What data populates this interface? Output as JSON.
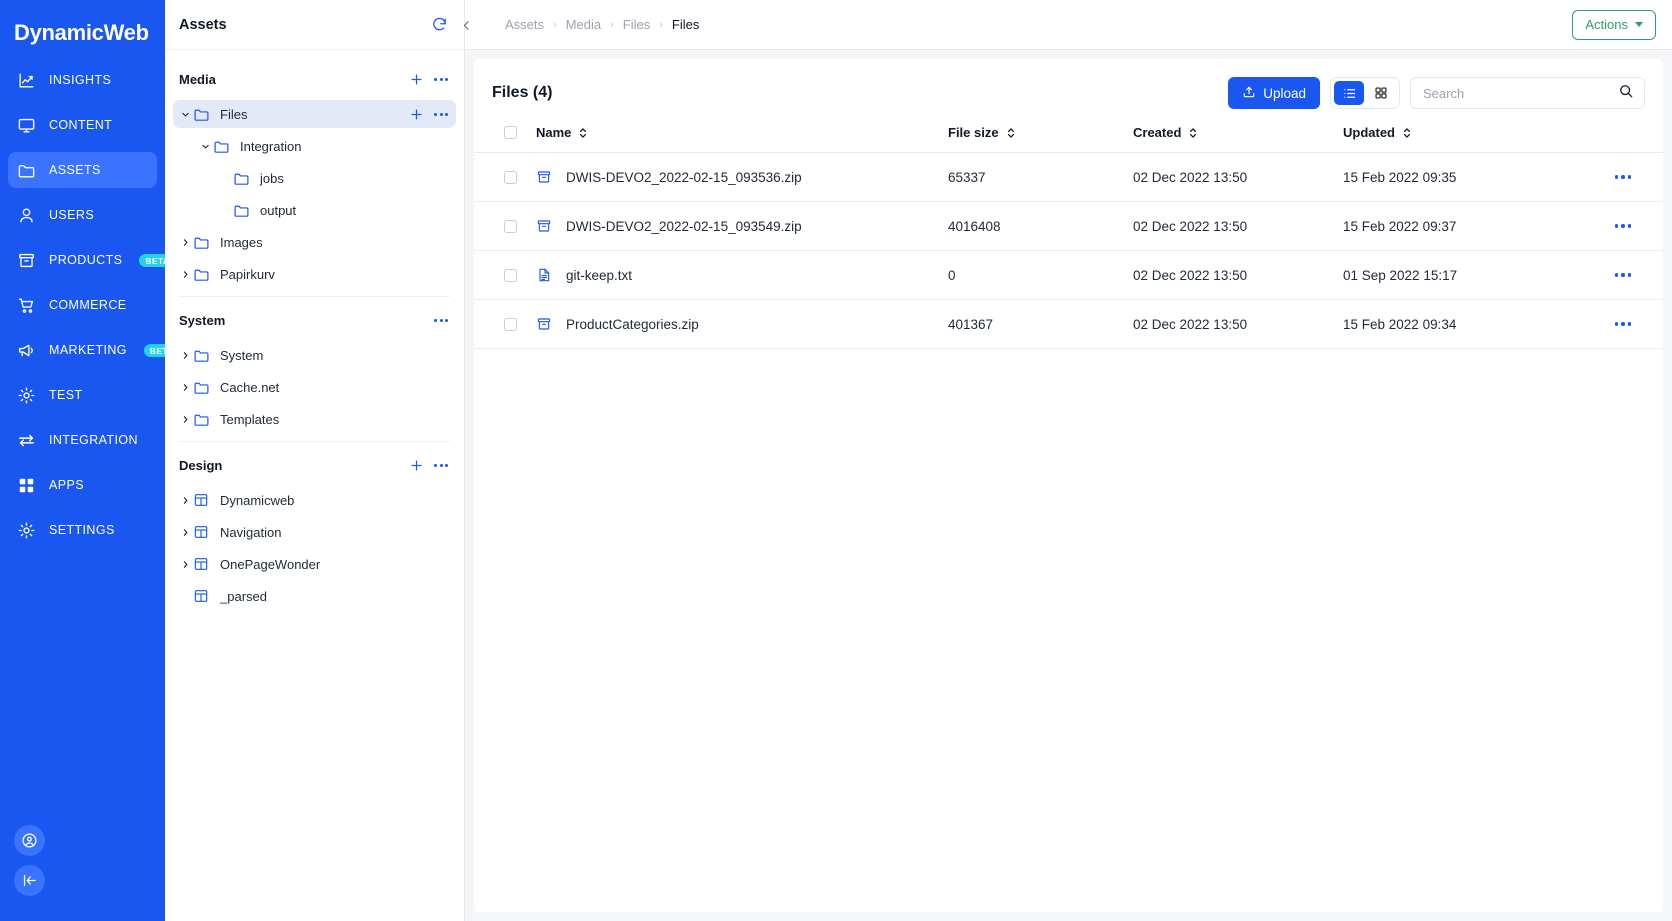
{
  "brand": {
    "name": "DynamicWeb",
    "accent": "#1a56f0",
    "accent_active": "#3a73ff",
    "beta_color": "#22d3ee",
    "actions_color": "#2e9e6b"
  },
  "nav": {
    "items": [
      {
        "label": "INSIGHTS",
        "icon": "chart-line-icon",
        "active": false,
        "badge": ""
      },
      {
        "label": "CONTENT",
        "icon": "monitor-icon",
        "active": false,
        "badge": ""
      },
      {
        "label": "ASSETS",
        "icon": "folder-icon",
        "active": true,
        "badge": ""
      },
      {
        "label": "USERS",
        "icon": "user-icon",
        "active": false,
        "badge": ""
      },
      {
        "label": "PRODUCTS",
        "icon": "archive-icon",
        "active": false,
        "badge": "BETA"
      },
      {
        "label": "COMMERCE",
        "icon": "cart-icon",
        "active": false,
        "badge": ""
      },
      {
        "label": "MARKETING",
        "icon": "megaphone-icon",
        "active": false,
        "badge": "BETA"
      },
      {
        "label": "TEST",
        "icon": "gear-icon",
        "active": false,
        "badge": ""
      },
      {
        "label": "INTEGRATION",
        "icon": "arrows-swap-icon",
        "active": false,
        "badge": ""
      },
      {
        "label": "APPS",
        "icon": "grid-icon",
        "active": false,
        "badge": ""
      },
      {
        "label": "SETTINGS",
        "icon": "gear-icon",
        "active": false,
        "badge": ""
      }
    ],
    "bottom": [
      {
        "icon": "account-circle-icon"
      },
      {
        "icon": "collapse-left-icon"
      }
    ]
  },
  "tree": {
    "title": "Assets",
    "refresh_icon": "refresh-icon",
    "groups": [
      {
        "title": "Media",
        "has_add": true,
        "has_more": true,
        "nodes": [
          {
            "label": "Files",
            "icon": "folder-icon",
            "indent": 0,
            "caret": "down",
            "selected": true,
            "has_add": true,
            "has_more": true
          },
          {
            "label": "Integration",
            "icon": "folder-icon",
            "indent": 1,
            "caret": "down",
            "selected": false,
            "has_add": false,
            "has_more": false
          },
          {
            "label": "jobs",
            "icon": "folder-icon",
            "indent": 2,
            "caret": "none",
            "selected": false,
            "has_add": false,
            "has_more": false
          },
          {
            "label": "output",
            "icon": "folder-icon",
            "indent": 2,
            "caret": "none",
            "selected": false,
            "has_add": false,
            "has_more": false
          },
          {
            "label": "Images",
            "icon": "folder-icon",
            "indent": 0,
            "caret": "right",
            "selected": false,
            "has_add": false,
            "has_more": false
          },
          {
            "label": "Papirkurv",
            "icon": "folder-icon",
            "indent": 0,
            "caret": "right",
            "selected": false,
            "has_add": false,
            "has_more": false
          }
        ]
      },
      {
        "title": "System",
        "has_add": false,
        "has_more": true,
        "nodes": [
          {
            "label": "System",
            "icon": "folder-icon",
            "indent": 0,
            "caret": "right",
            "selected": false,
            "has_add": false,
            "has_more": false
          },
          {
            "label": "Cache.net",
            "icon": "folder-icon",
            "indent": 0,
            "caret": "right",
            "selected": false,
            "has_add": false,
            "has_more": false
          },
          {
            "label": "Templates",
            "icon": "folder-icon",
            "indent": 0,
            "caret": "right",
            "selected": false,
            "has_add": false,
            "has_more": false
          }
        ]
      },
      {
        "title": "Design",
        "has_add": true,
        "has_more": true,
        "nodes": [
          {
            "label": "Dynamicweb",
            "icon": "layout-icon",
            "indent": 0,
            "caret": "right",
            "selected": false,
            "has_add": false,
            "has_more": false
          },
          {
            "label": "Navigation",
            "icon": "layout-icon",
            "indent": 0,
            "caret": "right",
            "selected": false,
            "has_add": false,
            "has_more": false
          },
          {
            "label": "OnePageWonder",
            "icon": "layout-icon",
            "indent": 0,
            "caret": "right",
            "selected": false,
            "has_add": false,
            "has_more": false
          },
          {
            "label": "_parsed",
            "icon": "layout-icon",
            "indent": 0,
            "caret": "none",
            "selected": false,
            "has_add": false,
            "has_more": false
          }
        ]
      }
    ]
  },
  "topbar": {
    "collapse_icon": "chevron-left-icon",
    "breadcrumbs": [
      "Assets",
      "Media",
      "Files",
      "Files"
    ],
    "actions_label": "Actions"
  },
  "content": {
    "title": "Files (4)",
    "upload_label": "Upload",
    "upload_icon": "upload-icon",
    "view_list_icon": "list-view-icon",
    "view_grid_icon": "grid-view-icon",
    "active_view": "list",
    "search": {
      "placeholder": "Search",
      "value": "",
      "icon": "search-icon"
    },
    "columns": [
      "Name",
      "File size",
      "Created",
      "Updated"
    ],
    "rows": [
      {
        "icon": "archive-file-icon",
        "name": "DWIS-DEVO2_2022-02-15_093536.zip",
        "size": "65337",
        "created": "02 Dec 2022 13:50",
        "updated": "15 Feb 2022 09:35",
        "checked": false
      },
      {
        "icon": "archive-file-icon",
        "name": "DWIS-DEVO2_2022-02-15_093549.zip",
        "size": "4016408",
        "created": "02 Dec 2022 13:50",
        "updated": "15 Feb 2022 09:37",
        "checked": false
      },
      {
        "icon": "text-file-icon",
        "name": "git-keep.txt",
        "size": "0",
        "created": "02 Dec 2022 13:50",
        "updated": "01 Sep 2022 15:17",
        "checked": false
      },
      {
        "icon": "archive-file-icon",
        "name": "ProductCategories.zip",
        "size": "401367",
        "created": "02 Dec 2022 13:50",
        "updated": "15 Feb 2022 09:34",
        "checked": false
      }
    ]
  }
}
